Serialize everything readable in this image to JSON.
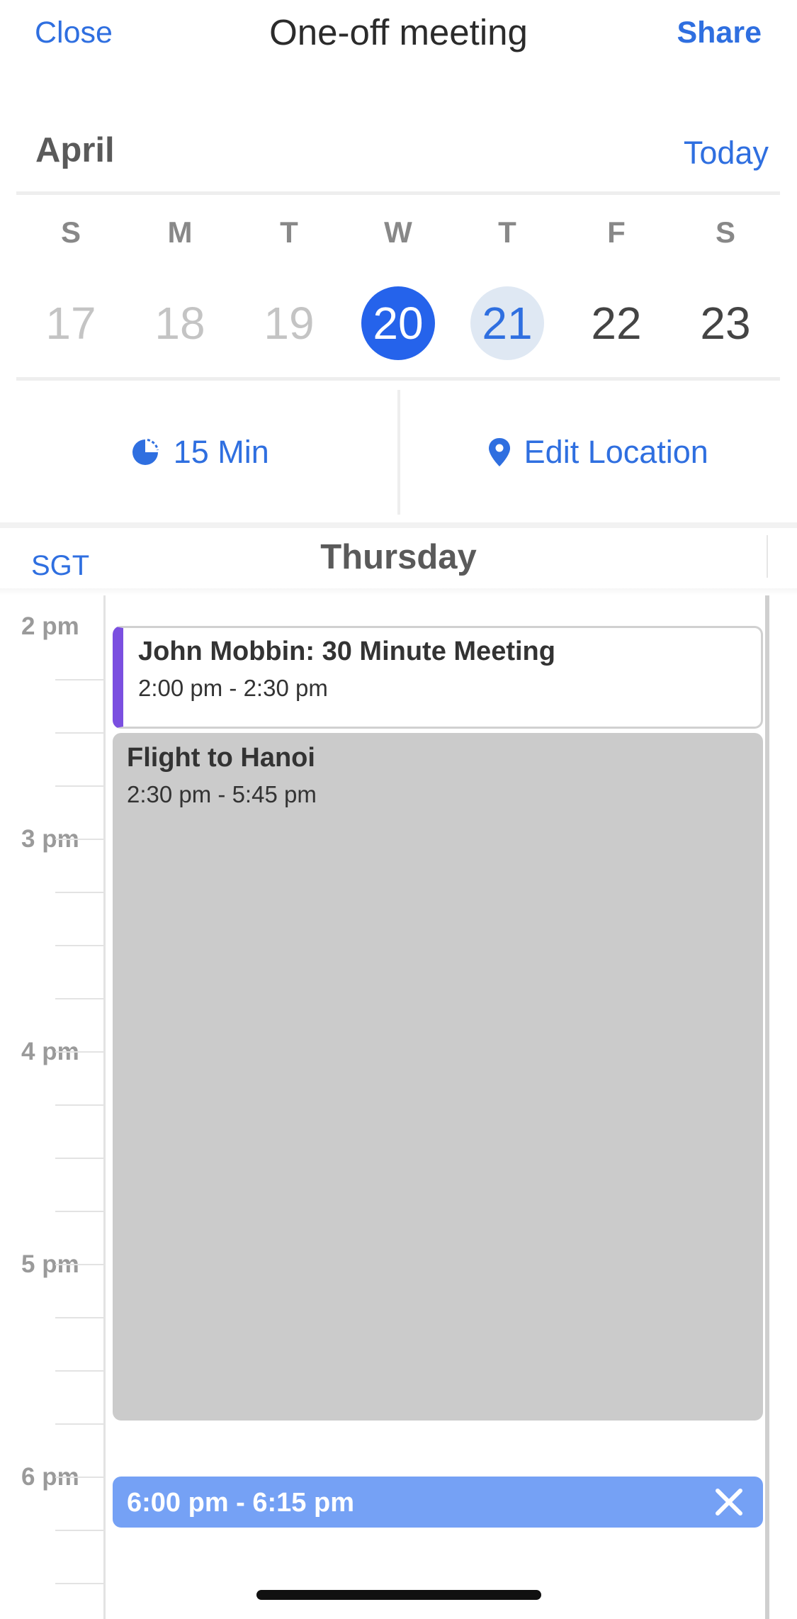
{
  "header": {
    "close_label": "Close",
    "title": "One-off meeting",
    "share_label": "Share"
  },
  "calendar": {
    "month": "April",
    "today_label": "Today",
    "weekdays": [
      "S",
      "M",
      "T",
      "W",
      "T",
      "F",
      "S"
    ],
    "dates": [
      "17",
      "18",
      "19",
      "20",
      "21",
      "22",
      "23"
    ]
  },
  "options": {
    "duration_label": "15 Min",
    "location_label": "Edit Location"
  },
  "schedule": {
    "timezone": "SGT",
    "day": "Thursday",
    "hours": [
      "2 pm",
      "3 pm",
      "4 pm",
      "5 pm",
      "6 pm"
    ],
    "events": [
      {
        "title": "John Mobbin: 30 Minute Meeting",
        "time": "2:00 pm - 2:30 pm",
        "color": "#7b4fe0"
      },
      {
        "title": "Flight to Hanoi",
        "time": "2:30 pm - 5:45 pm",
        "color": "#cbcbcb"
      }
    ],
    "new_slot": {
      "time": "6:00 pm - 6:15 pm",
      "color": "#75a1f5"
    }
  },
  "colors": {
    "accent": "#2f6fe0",
    "selected_date": "#2563eb",
    "today_date": "#dfe8f3"
  }
}
